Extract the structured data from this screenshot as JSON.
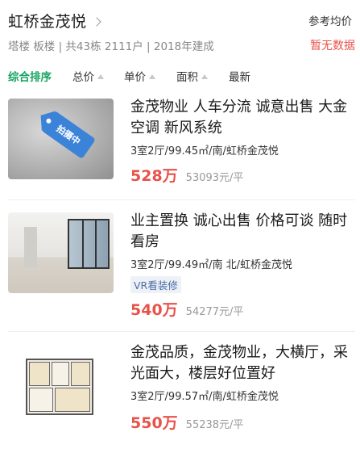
{
  "header": {
    "title": "虹桥金茂悦",
    "subtitle": "塔楼 板楼 | 共43栋 2111户 | 2018年建成",
    "ref_label": "参考均价",
    "ref_value": "暂无数据"
  },
  "sort": {
    "items": [
      {
        "label": "综合排序",
        "active": true,
        "arrow": false
      },
      {
        "label": "总价",
        "active": false,
        "arrow": true
      },
      {
        "label": "单价",
        "active": false,
        "arrow": true
      },
      {
        "label": "面积",
        "active": false,
        "arrow": true
      },
      {
        "label": "最新",
        "active": false,
        "arrow": false
      }
    ]
  },
  "listings": [
    {
      "desc": "金茂物业 人车分流 诚意出售 大金空调 新风系统",
      "meta": "3室2厅/99.45㎡/南/虹桥金茂悦",
      "price": "528万",
      "unit_price": "53093元/平",
      "tag_text": "拍摄中"
    },
    {
      "desc": "业主置换 诚心出售 价格可谈 随时看房",
      "meta": "3室2厅/99.49㎡/南 北/虹桥金茂悦",
      "vr_tag": "VR看装修",
      "price": "540万",
      "unit_price": "54277元/平"
    },
    {
      "desc": "金茂品质，金茂物业，大横厅，采光面大，楼层好位置好",
      "meta": "3室2厅/99.57㎡/南/虹桥金茂悦",
      "price": "550万",
      "unit_price": "55238元/平"
    }
  ],
  "colors": {
    "accent_green": "#19a463",
    "price_red": "#e8524a",
    "tag_blue": "#3b82d9"
  }
}
